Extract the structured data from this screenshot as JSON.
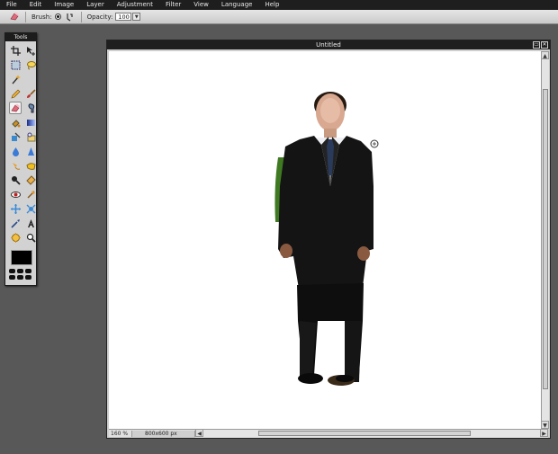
{
  "menubar": {
    "items": [
      "File",
      "Edit",
      "Image",
      "Layer",
      "Adjustment",
      "Filter",
      "View",
      "Language",
      "Help"
    ]
  },
  "options": {
    "brush_label": "Brush:",
    "opacity_label": "Opacity:",
    "opacity_value": "100"
  },
  "tools": {
    "title": "Tools",
    "items": [
      "crop-tool",
      "move-tool",
      "marquee-tool",
      "lasso-tool",
      "magic-wand-tool",
      "pencil-tool",
      "brush-tool",
      "eraser-tool",
      "clone-tool",
      "fill-tool",
      "gradient-tool",
      "color-replace-tool",
      "drawing-tool",
      "sponge-tool",
      "blur-tool",
      "sharpen-tool",
      "smudge-tool",
      "dodge-tool",
      "burn-tool",
      "bloat-tool",
      "red-eye-tool",
      "pinch-tool",
      "spherize-tool",
      "color-picker-tool",
      "type-tool",
      "hand-tool",
      "zoom-tool"
    ],
    "selected": "eraser-tool",
    "foreground_color": "#000000"
  },
  "document": {
    "title": "Untitled",
    "zoom": "160 %",
    "dimensions": "800x600 px"
  }
}
